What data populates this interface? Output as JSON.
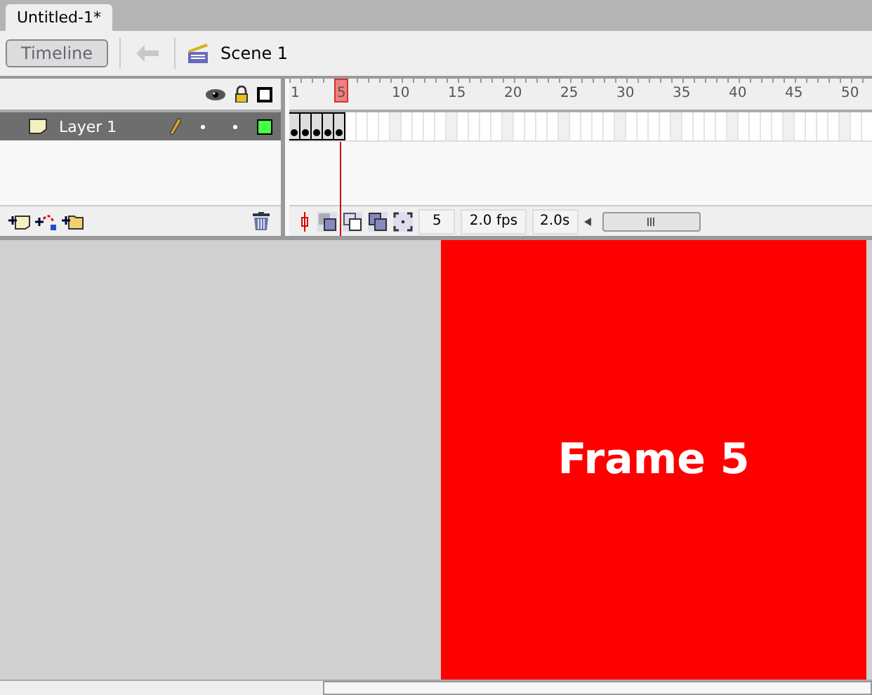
{
  "document_tab": {
    "title": "Untitled-1*",
    "selected": true
  },
  "toolbar": {
    "timeline_button": "Timeline",
    "scene": "Scene 1"
  },
  "ruler": [
    {
      "label": "1",
      "selected": false
    },
    {
      "label": "5",
      "selected": true
    },
    {
      "label": "10",
      "selected": false
    },
    {
      "label": "15",
      "selected": false
    },
    {
      "label": "20",
      "selected": false
    },
    {
      "label": "25",
      "selected": false
    },
    {
      "label": "30",
      "selected": false
    },
    {
      "label": "35",
      "selected": false
    },
    {
      "label": "40",
      "selected": false
    },
    {
      "label": "45",
      "selected": false
    },
    {
      "label": "50",
      "selected": false
    }
  ],
  "layers": [
    {
      "name": "Layer 1",
      "selected": true,
      "color": "#44ff44",
      "frames": [
        {
          "keyframe": true
        },
        {
          "keyframe": true
        },
        {
          "keyframe": true
        },
        {
          "keyframe": true
        },
        {
          "keyframe": true
        }
      ]
    }
  ],
  "status": {
    "frame": "5",
    "fps": "2.0 fps",
    "time": "2.0s"
  },
  "stage": {
    "text": "Frame 5"
  }
}
